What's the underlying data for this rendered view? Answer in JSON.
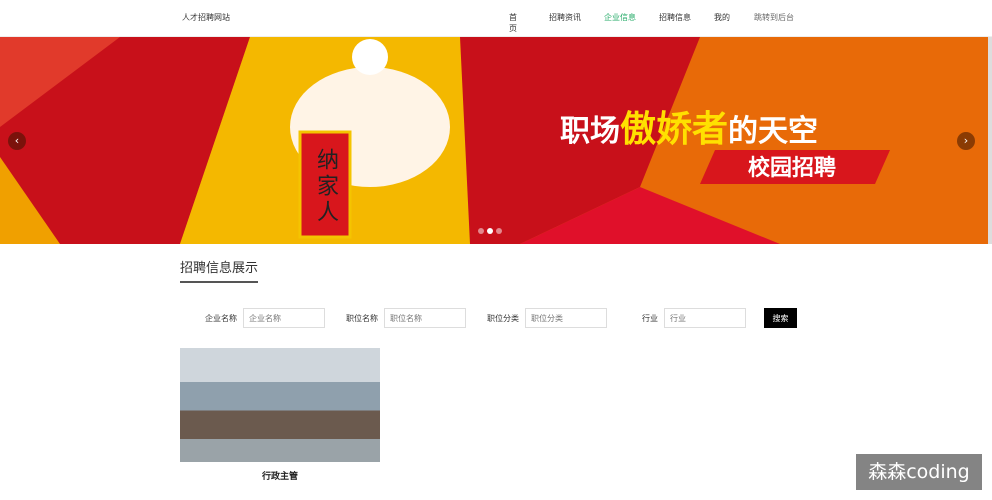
{
  "header": {
    "logo": "人才招聘网站",
    "nav": [
      "首页",
      "招聘资讯",
      "企业信息",
      "招聘信息",
      "我的",
      "跳转到后台"
    ]
  },
  "banner": {
    "headline": "职场傲娇者的天空",
    "subline": "校园招聘",
    "scroll_text": "纳家人",
    "active_slide": 2,
    "slide_count": 3
  },
  "section": {
    "title": "招聘信息展示"
  },
  "filters": [
    {
      "label": "企业名称",
      "placeholder": "企业名称"
    },
    {
      "label": "职位名称",
      "placeholder": "职位名称"
    },
    {
      "label": "职位分类",
      "placeholder": "职位分类"
    },
    {
      "label": "行业",
      "placeholder": "行业"
    }
  ],
  "search_label": "搜索",
  "jobs": [
    {
      "title": "行政主管"
    }
  ],
  "watermark": "森森coding"
}
